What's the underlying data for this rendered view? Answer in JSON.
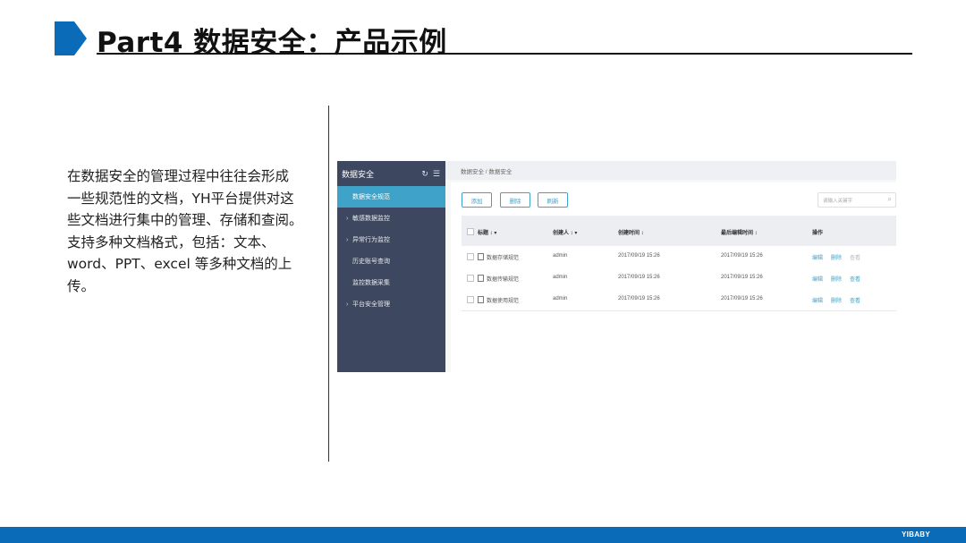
{
  "slide": {
    "title": "Part4 数据安全：产品示例",
    "description_lines": [
      "在数据安全的管理过程中往往会形成",
      "一些规范性的文档，YH平台提供对这",
      "些文档进行集中的管理、存储和查阅。",
      "支持多种文档格式，包括：文本、",
      "word、PPT、excel 等多种文档的上",
      "传。"
    ],
    "brand": "YIBABY",
    "accent_color": "#0a6bb8"
  },
  "app": {
    "sidebar": {
      "title": "数据安全",
      "items": [
        {
          "label": "数据安全规范",
          "active": true,
          "expandable": false
        },
        {
          "label": "敏感数据监控",
          "active": false,
          "expandable": true
        },
        {
          "label": "异常行为监控",
          "active": false,
          "expandable": true
        },
        {
          "label": "历史账号查询",
          "active": false,
          "expandable": false
        },
        {
          "label": "监控数据采集",
          "active": false,
          "expandable": false
        },
        {
          "label": "平台安全管理",
          "active": false,
          "expandable": true
        }
      ],
      "bg_color": "#3d475f",
      "active_color": "#3fa3c9"
    },
    "breadcrumb": "数据安全 / 数据安全",
    "toolbar": {
      "add": "添加",
      "delete": "删除",
      "refresh": "刷新"
    },
    "search": {
      "placeholder": "请输入关键字"
    },
    "table": {
      "columns": [
        "标题 ↕ ▾",
        "创建人 ↕ ▾",
        "创建时间 ↕",
        "最后编辑时间 ↕",
        "操作"
      ],
      "rows": [
        {
          "title": "数据存储规范",
          "creator": "admin",
          "created": "2017/09/19 15:26",
          "edited": "2017/09/19 15:26",
          "actions": [
            "编辑",
            "删除",
            "查看"
          ]
        },
        {
          "title": "数据传输规范",
          "creator": "admin",
          "created": "2017/09/19 15:26",
          "edited": "2017/09/19 15:26",
          "actions": [
            "编辑",
            "删除",
            "查看"
          ]
        },
        {
          "title": "数据使用规范",
          "creator": "admin",
          "created": "2017/09/19 15:26",
          "edited": "2017/09/19 15:26",
          "actions": [
            "编辑",
            "删除",
            "查看"
          ]
        }
      ]
    }
  }
}
